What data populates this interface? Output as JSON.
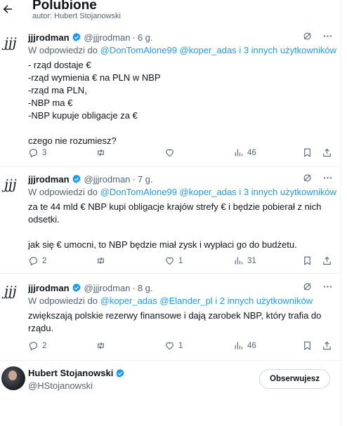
{
  "header": {
    "title": "Polubione",
    "subtitle": "autor: Hubert Stojanowski"
  },
  "tweets": [
    {
      "avatar": "jjj",
      "name": "jjjrodman",
      "handle": "@jjjrodman",
      "time": "6 g.",
      "reply_prefix": "W odpowiedzi do",
      "reply_mentions": "@DonTomAlone99 @koper_adas",
      "reply_more": "i 3 innych użytkowników",
      "text": "- rząd dostaje €\n-rząd wymienia € na PLN w NBP\n-rząd ma PLN,\n-NBP ma €\n-NBP kupuje obligacje za €\n\nczego nie rozumiesz?",
      "replies": "3",
      "reposts": "",
      "likes": "",
      "views": "46"
    },
    {
      "avatar": "jjj",
      "name": "jjjrodman",
      "handle": "@jjjrodman",
      "time": "7 g.",
      "reply_prefix": "W odpowiedzi do",
      "reply_mentions": "@DonTomAlone99 @koper_adas",
      "reply_more": "i 3 innych użytkowników",
      "text": "za te 44 mld € NBP kupi obligacje krajów strefy € i będzie pobierał z nich odsetki.\n\njak się € umocni, to NBP będzie miał zysk i wypłaci go do budżetu.",
      "replies": "2",
      "reposts": "",
      "likes": "1",
      "views": "31"
    },
    {
      "avatar": "jjj",
      "name": "jjjrodman",
      "handle": "@jjjrodman",
      "time": "8 g.",
      "reply_prefix": "W odpowiedzi do",
      "reply_mentions": "@koper_adas @Elander_pl",
      "reply_more": "i 2 innych użytkowników",
      "text": "zwiększają polskie rezerwy finansowe i dają zarobek NBP, który trafia do rządu.",
      "replies": "2",
      "reposts": "",
      "likes": "1",
      "views": "46"
    }
  ],
  "profile": {
    "name": "Hubert Stojanowski",
    "handle": "@HStojanowski",
    "follow_label": "Obserwujesz"
  },
  "colors": {
    "accent": "#1d9bf0",
    "secondary_text": "#536471",
    "divider": "#eff3f4"
  },
  "icons": [
    "back-arrow-icon",
    "verified-badge-icon",
    "grok-icon",
    "more-icon",
    "reply-icon",
    "repost-icon",
    "like-icon",
    "views-icon",
    "bookmark-icon",
    "share-icon"
  ]
}
